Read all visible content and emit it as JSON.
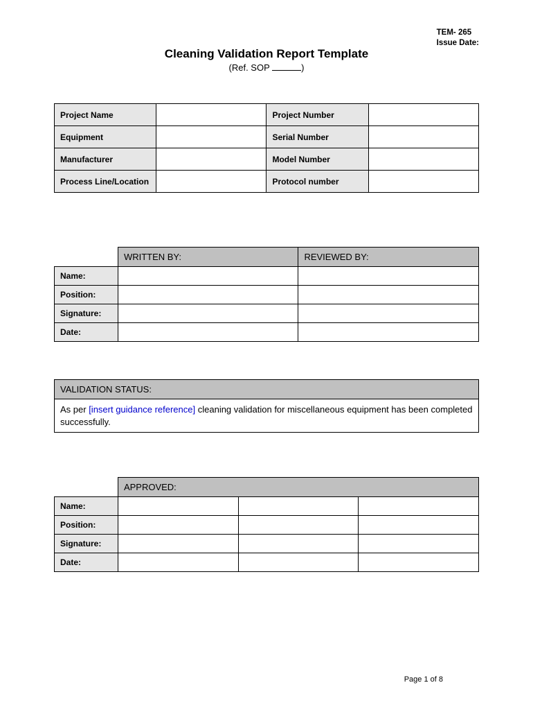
{
  "header": {
    "tem": "TEM- 265",
    "issue_date_label": "Issue Date:",
    "issue_date_value": ""
  },
  "title": "Cleaning Validation Report Template",
  "subtitle_prefix": "(Ref. SOP ",
  "subtitle_suffix": ")",
  "sop_ref": "",
  "info_table": {
    "rows": [
      {
        "label1": "Project Name",
        "value1": "",
        "label2": "Project Number",
        "value2": ""
      },
      {
        "label1": "Equipment",
        "value1": "",
        "label2": "Serial Number",
        "value2": ""
      },
      {
        "label1": "Manufacturer",
        "value1": "",
        "label2": "Model Number",
        "value2": ""
      },
      {
        "label1": "Process Line/Location",
        "value1": "",
        "label2": "Protocol number",
        "value2": ""
      }
    ]
  },
  "signoff": {
    "col1": "WRITTEN BY:",
    "col2": "REVIEWED BY:",
    "rows": [
      {
        "label": "Name:",
        "v1": "",
        "v2": ""
      },
      {
        "label": "Position:",
        "v1": "",
        "v2": ""
      },
      {
        "label": "Signature:",
        "v1": "",
        "v2": ""
      },
      {
        "label": "Date:",
        "v1": "",
        "v2": ""
      }
    ]
  },
  "validation_status": {
    "header": "VALIDATION STATUS:",
    "body_prefix": "As per ",
    "body_ref": "[insert guidance reference]",
    "body_suffix": " cleaning validation for miscellaneous equipment has been completed successfully."
  },
  "approved": {
    "header": "APPROVED:",
    "rows": [
      {
        "label": "Name:",
        "v1": "",
        "v2": "",
        "v3": ""
      },
      {
        "label": "Position:",
        "v1": "",
        "v2": "",
        "v3": ""
      },
      {
        "label": "Signature:",
        "v1": "",
        "v2": "",
        "v3": ""
      },
      {
        "label": "Date:",
        "v1": "",
        "v2": "",
        "v3": ""
      }
    ]
  },
  "footer": {
    "page_label": "Page ",
    "page_current": "1",
    "page_of": " of ",
    "page_total": "8"
  }
}
